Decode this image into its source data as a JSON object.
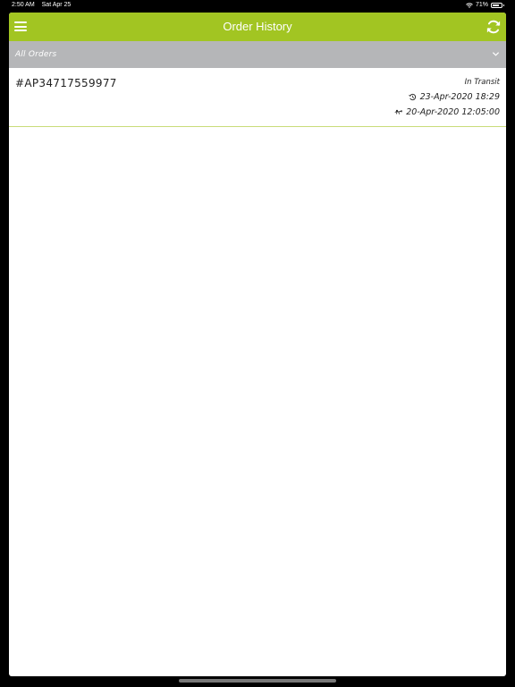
{
  "status_bar": {
    "time": "2:50 AM",
    "date": "Sat Apr 25",
    "battery": "71%",
    "wifi_icon": "wifi-icon",
    "battery_icon": "battery-icon"
  },
  "nav": {
    "title": "Order History",
    "menu_icon": "menu-icon",
    "refresh_icon": "refresh-icon",
    "accent_color": "#a2c522"
  },
  "filter": {
    "selected": "All Orders",
    "icon": "chevron-down-icon",
    "background_color": "#b5b6b8"
  },
  "orders": [
    {
      "id": "#AP34717559977",
      "status": "In Transit",
      "placed_at": "23-Apr-2020 18:29",
      "placed_icon": "clock-icon",
      "delivery_at": "20-Apr-2020 12:05:00",
      "delivery_icon": "delivery-icon"
    }
  ]
}
